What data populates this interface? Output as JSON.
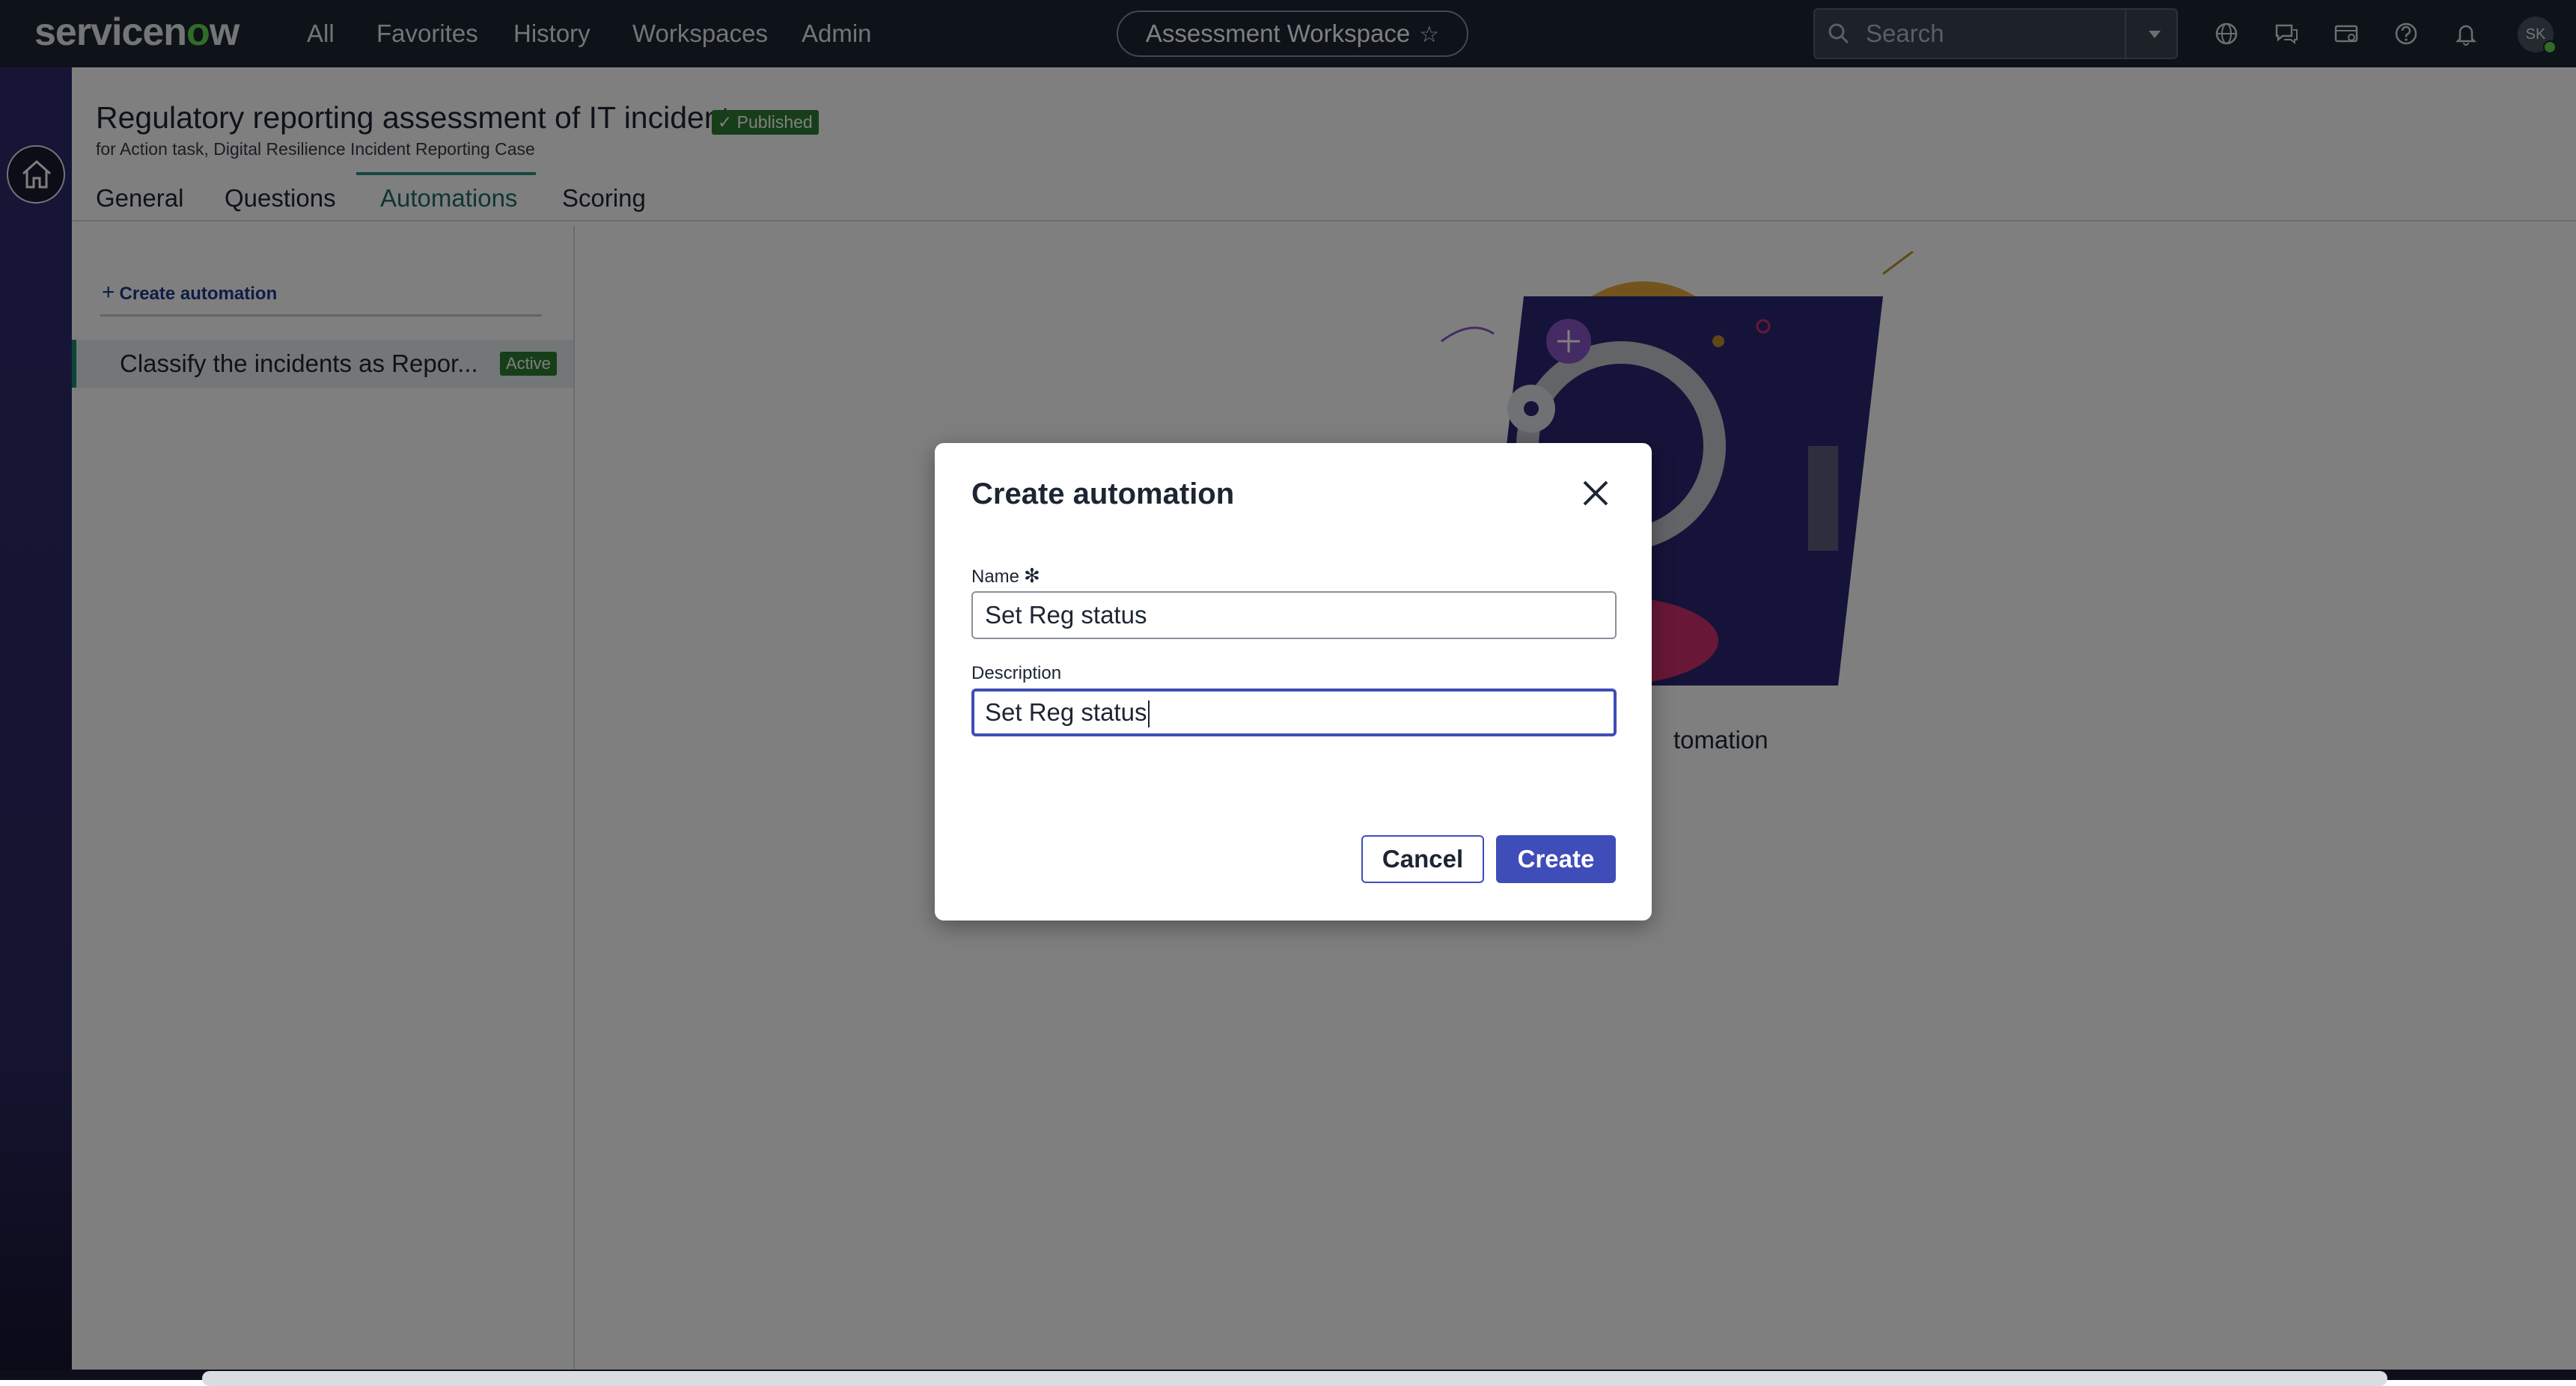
{
  "header": {
    "logo_prefix": "servicen",
    "logo_o": "o",
    "logo_suffix": "w",
    "nav": [
      "All",
      "Favorites",
      "History",
      "Workspaces",
      "Admin"
    ],
    "workspace_title": "Assessment Workspace",
    "search_placeholder": "Search",
    "user_initials": "SK",
    "icons": [
      "globe-icon",
      "chat-icon",
      "card-icon",
      "help-icon",
      "bell-icon"
    ]
  },
  "page": {
    "title": "Regulatory reporting assessment of IT incidents",
    "status_badge": "Published",
    "subtitle": "for Action task, Digital Resilience Incident Reporting Case",
    "tabs": [
      "General",
      "Questions",
      "Automations",
      "Scoring"
    ],
    "active_tab": "Automations"
  },
  "left_panel": {
    "create_link": "Create automation",
    "items": [
      {
        "label": "Classify the incidents as Repor...",
        "status": "Active"
      }
    ]
  },
  "empty_state": {
    "text_visible": "tomation"
  },
  "modal": {
    "title": "Create automation",
    "name_label": "Name",
    "name_value": "Set Reg status",
    "description_label": "Description",
    "description_value": "Set Reg status",
    "cancel_label": "Cancel",
    "create_label": "Create"
  },
  "colors": {
    "header_bg": "#1d2533",
    "rail_bg": "#2f2b6e",
    "primary": "#3f4db8",
    "success": "#2e7d32",
    "active_tab": "#1f6e66"
  }
}
